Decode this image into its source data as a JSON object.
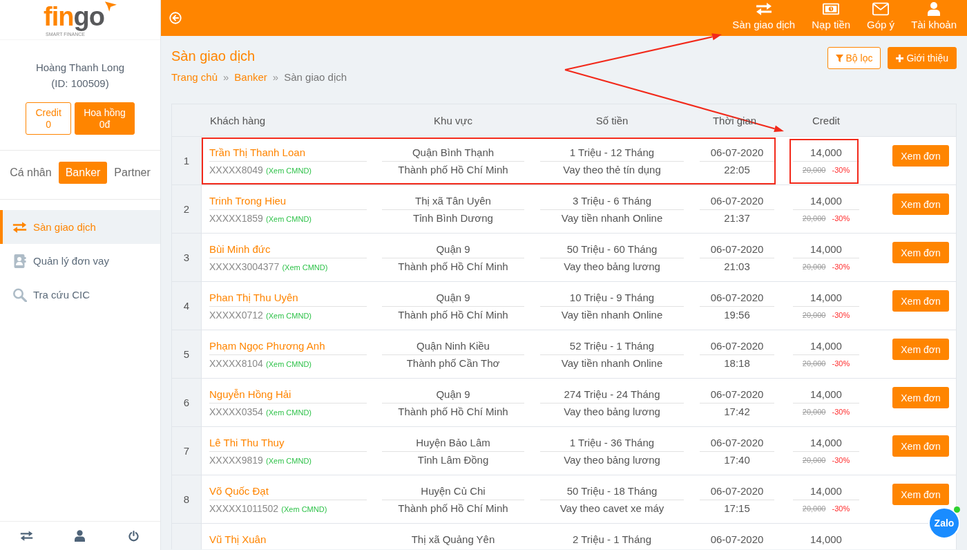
{
  "sidebar": {
    "logo": {
      "lead": "fin",
      "tail": "go",
      "tagline": "SMART FINANCE"
    },
    "user": {
      "name": "Hoàng Thanh Long",
      "id": "(ID: 100509)"
    },
    "wallet": [
      {
        "kind": "outline",
        "label": "Credit",
        "value": "0"
      },
      {
        "kind": "filled",
        "label": "Hoa hồng",
        "value": "0đ"
      }
    ],
    "roles": [
      {
        "label": "Cá nhân",
        "selected": false
      },
      {
        "label": "Banker",
        "selected": true
      },
      {
        "label": "Partner",
        "selected": false
      }
    ],
    "menu": [
      {
        "label": "Sàn giao dịch",
        "selected": true
      },
      {
        "label": "Quản lý đơn vay",
        "selected": false
      },
      {
        "label": "Tra cứu CIC",
        "selected": false
      }
    ]
  },
  "topbar": {
    "nav": [
      {
        "label": "Sàn giao dịch"
      },
      {
        "label": "Nạp tiền"
      },
      {
        "label": "Góp ý"
      },
      {
        "label": "Tài khoản"
      }
    ]
  },
  "page": {
    "title": "Sàn giao dịch",
    "breadcrumb": [
      {
        "kind": "link",
        "text": "Trang chủ"
      },
      {
        "kind": "separator",
        "text": "»"
      },
      {
        "kind": "link",
        "text": "Banker"
      },
      {
        "kind": "separator",
        "text": "»"
      },
      {
        "kind": "current",
        "text": "Sàn giao dịch"
      }
    ],
    "actions": [
      {
        "kind": "outline",
        "label": "Bộ lọc"
      },
      {
        "kind": "filled",
        "label": "Giới thiệu"
      }
    ]
  },
  "table": {
    "columns": [
      "Khách hàng",
      "Khu vực",
      "Số tiền",
      "Thời gian",
      "Credit"
    ],
    "rows": [
      {
        "index": "1",
        "highlighted": true,
        "customer": "Trần Thị Thanh Loan",
        "id_number": "XXXXX8049",
        "id_link": "(Xem CMND)",
        "district": "Quận Bình Thạnh",
        "province": "Thành phố Hồ Chí Minh",
        "amount": "1 Triệu - 12 Tháng",
        "loan_type": "Vay theo thẻ tín dụng",
        "date": "06-07-2020",
        "time": "22:05",
        "credit": "14,000",
        "old_credit": "20,000",
        "discount": "-30%",
        "action": "Xem đơn"
      },
      {
        "index": "2",
        "highlighted": false,
        "customer": "Trinh Trong Hieu",
        "id_number": "XXXXX1859",
        "id_link": "(Xem CMND)",
        "district": "Thị xã Tân Uyên",
        "province": "Tỉnh Bình Dương",
        "amount": "3 Triệu - 6 Tháng",
        "loan_type": "Vay tiền nhanh Online",
        "date": "06-07-2020",
        "time": "21:37",
        "credit": "14,000",
        "old_credit": "20,000",
        "discount": "-30%",
        "action": "Xem đơn"
      },
      {
        "index": "3",
        "highlighted": false,
        "customer": "Bùi Minh đức",
        "id_number": "XXXXX3004377",
        "id_link": "(Xem CMND)",
        "district": "Quận 9",
        "province": "Thành phố Hồ Chí Minh",
        "amount": "50 Triệu - 60 Tháng",
        "loan_type": "Vay theo bảng lương",
        "date": "06-07-2020",
        "time": "21:03",
        "credit": "14,000",
        "old_credit": "20,000",
        "discount": "-30%",
        "action": "Xem đơn"
      },
      {
        "index": "4",
        "highlighted": false,
        "customer": "Phan Thị Thu Uyên",
        "id_number": "XXXXX0712",
        "id_link": "(Xem CMND)",
        "district": "Quận 9",
        "province": "Thành phố Hồ Chí Minh",
        "amount": "10 Triệu - 9 Tháng",
        "loan_type": "Vay tiền nhanh Online",
        "date": "06-07-2020",
        "time": "19:56",
        "credit": "14,000",
        "old_credit": "20,000",
        "discount": "-30%",
        "action": "Xem đơn"
      },
      {
        "index": "5",
        "highlighted": false,
        "customer": "Phạm Ngọc Phương Anh",
        "id_number": "XXXXX8104",
        "id_link": "(Xem CMND)",
        "district": "Quận Ninh Kiều",
        "province": "Thành phố Cần Thơ",
        "amount": "52 Triệu - 1 Tháng",
        "loan_type": "Vay tiền nhanh Online",
        "date": "06-07-2020",
        "time": "18:18",
        "credit": "14,000",
        "old_credit": "20,000",
        "discount": "-30%",
        "action": "Xem đơn"
      },
      {
        "index": "6",
        "highlighted": false,
        "customer": "Nguyễn Hồng Hải",
        "id_number": "XXXXX0354",
        "id_link": "(Xem CMND)",
        "district": "Quận 9",
        "province": "Thành phố Hồ Chí Minh",
        "amount": "274 Triệu - 24 Tháng",
        "loan_type": "Vay theo bảng lương",
        "date": "06-07-2020",
        "time": "17:42",
        "credit": "14,000",
        "old_credit": "20,000",
        "discount": "-30%",
        "action": "Xem đơn"
      },
      {
        "index": "7",
        "highlighted": false,
        "customer": "Lê Thi Thu Thuy",
        "id_number": "XXXXX9819",
        "id_link": "(Xem CMND)",
        "district": "Huyện Bảo Lâm",
        "province": "Tỉnh Lâm Đồng",
        "amount": "1 Triệu - 36 Tháng",
        "loan_type": "Vay theo bảng lương",
        "date": "06-07-2020",
        "time": "17:40",
        "credit": "14,000",
        "old_credit": "20,000",
        "discount": "-30%",
        "action": "Xem đơn"
      },
      {
        "index": "8",
        "highlighted": false,
        "customer": "Võ Quốc Đạt",
        "id_number": "XXXXX1011502",
        "id_link": "(Xem CMND)",
        "district": "Huyện Củ Chi",
        "province": "Thành phố Hồ Chí Minh",
        "amount": "50 Triệu - 18 Tháng",
        "loan_type": "Vay theo cavet xe máy",
        "date": "06-07-2020",
        "time": "17:15",
        "credit": "14,000",
        "old_credit": "20,000",
        "discount": "-30%",
        "action": "Xem đơn"
      },
      {
        "highlighted": false,
        "customer": "Vũ Thị Xuân",
        "district": "Thị xã Quảng Yên",
        "amount": "2 Triệu - 1 Tháng",
        "date": "06-07-2020",
        "credit": "14,000"
      }
    ]
  },
  "chat_widget": {
    "label": "Zalo"
  }
}
